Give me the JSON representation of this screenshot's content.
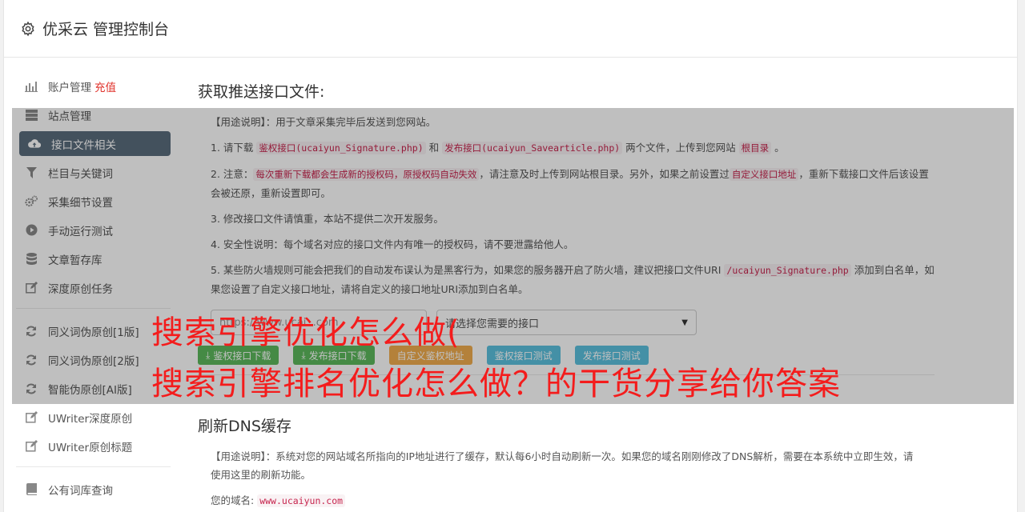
{
  "header": {
    "title": "优采云 管理控制台",
    "icon": "gear-icon"
  },
  "sidebar": {
    "items": [
      {
        "label": "账户管理",
        "extra": "充值",
        "icon": "bar-chart-icon"
      },
      {
        "label": "站点管理",
        "icon": "server-icon"
      },
      {
        "label": "接口文件相关",
        "icon": "cloud-upload-icon",
        "active": true
      },
      {
        "label": "栏目与关键词",
        "icon": "filter-icon"
      },
      {
        "label": "采集细节设置",
        "icon": "gears-icon"
      },
      {
        "label": "手动运行测试",
        "icon": "play-circle-icon"
      },
      {
        "label": "文章暂存库",
        "icon": "database-icon"
      },
      {
        "label": "深度原创任务",
        "icon": "edit-icon"
      }
    ],
    "items2": [
      {
        "label": "同义词伪原创[1版]",
        "icon": "refresh-icon"
      },
      {
        "label": "同义词伪原创[2版]",
        "icon": "refresh-icon"
      },
      {
        "label": "智能伪原创[AI版]",
        "icon": "refresh-icon"
      },
      {
        "label": "UWriter深度原创",
        "icon": "edit-icon"
      },
      {
        "label": "UWriter原创标题",
        "icon": "edit-icon"
      }
    ],
    "items3": [
      {
        "label": "公有词库查询",
        "icon": "book-icon"
      }
    ]
  },
  "section1": {
    "title": "获取推送接口文件:",
    "usage": "【用途说明】：用于文章采集完毕后发送到您网站。",
    "p1_pre": "1. 请下载 ",
    "p1_code1": "鉴权接口(ucaiyun_Signature.php)",
    "p1_mid": " 和 ",
    "p1_code2": "发布接口(ucaiyun_Savearticle.php)",
    "p1_post": " 两个文件，上传到您网站 ",
    "p1_code3": "根目录",
    "p1_end": " 。",
    "p2_pre": "2. 注意：",
    "p2_code1": "每次重新下载都会生成新的授权码，原授权码自动失效",
    "p2_mid": "，请注意及时上传到网站根目录。另外，如果之前设置过",
    "p2_code2": "自定义接口地址",
    "p2_post": "，重新下载接口文件后该设置会被还原，重新设置即可。",
    "p3": "3. 修改接口文件请慎重，本站不提供二次开发服务。",
    "p4": "4. 安全性说明：每个域名对应的接口文件内有唯一的授权码，请不要泄露给他人。",
    "p5_pre": "5. 某些防火墙规则可能会把我们的自动发布误认为是黑客行为，如果您的服务器开启了防火墙，建议把接口文件URI ",
    "p5_code": "/ucaiyun_Signature.php",
    "p5_post": " 添加到白名单，如果您设置了自定义接口地址，请将自定义的接口地址URI添加到白名单。",
    "site_value": "https://www.ucai...com",
    "select_placeholder": "请选择您需要的接口",
    "buttons": {
      "auth_download": "鉴权接口下载",
      "publish_download": "发布接口下载",
      "custom_auth": "自定义鉴权地址",
      "auth_test": "鉴权接口测试",
      "publish_test": "发布接口测试"
    }
  },
  "overlay_text": {
    "line1": "搜索引擎优化怎么做(",
    "line2": "搜索引擎排名优化怎么做？的干货分享给你答案"
  },
  "section2": {
    "title": "刷新DNS缓存",
    "usage": "【用途说明】：系统对您的网站域名所指向的IP地址进行了缓存，默认每6小时自动刷新一次。如果您的域名刚刚修改了DNS解析，需要在本系统中立即生效，请使用这里的刷新功能。",
    "domain_label": "您的域名:",
    "domain_value": "www.ucaiyun.com"
  },
  "colors": {
    "accent_red": "#e0322b",
    "overlay_text": "#f41c1c",
    "active_nav": "#5a6c7d"
  }
}
